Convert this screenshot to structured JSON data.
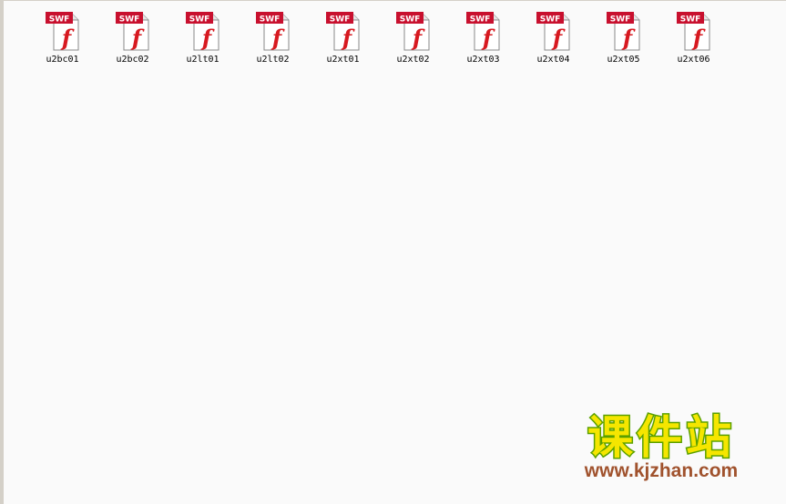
{
  "colors": {
    "background": "#fafafa",
    "frame": "#d4d0c8",
    "swf_badge_red": "#c8102e",
    "flash_f_red": "#d71920",
    "watermark_main": "#f5e600",
    "watermark_outline": "#5aa000",
    "watermark_url": "#a0522d"
  },
  "files": [
    {
      "name": "u2bc01",
      "icon": "swf-file-icon",
      "badge": "SWF"
    },
    {
      "name": "u2bc02",
      "icon": "swf-file-icon",
      "badge": "SWF"
    },
    {
      "name": "u2lt01",
      "icon": "swf-file-icon",
      "badge": "SWF"
    },
    {
      "name": "u2lt02",
      "icon": "swf-file-icon",
      "badge": "SWF"
    },
    {
      "name": "u2xt01",
      "icon": "swf-file-icon",
      "badge": "SWF"
    },
    {
      "name": "u2xt02",
      "icon": "swf-file-icon",
      "badge": "SWF"
    },
    {
      "name": "u2xt03",
      "icon": "swf-file-icon",
      "badge": "SWF"
    },
    {
      "name": "u2xt04",
      "icon": "swf-file-icon",
      "badge": "SWF"
    },
    {
      "name": "u2xt05",
      "icon": "swf-file-icon",
      "badge": "SWF"
    },
    {
      "name": "u2xt06",
      "icon": "swf-file-icon",
      "badge": "SWF"
    }
  ],
  "watermark": {
    "title": "课件站",
    "url": "www.kjzhan.com"
  }
}
